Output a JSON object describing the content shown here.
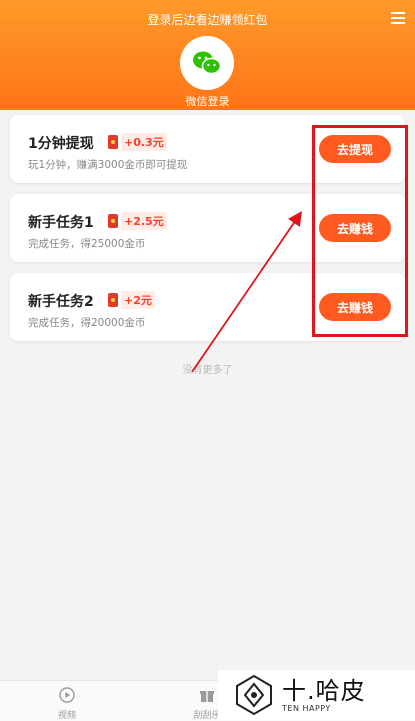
{
  "header": {
    "title": "登录后边看边赚领红包",
    "login_label": "微信登录"
  },
  "tasks": [
    {
      "title": "1分钟提现",
      "reward": "+0.3元",
      "desc": "玩1分钟，赚满3000金币即可提现",
      "button": "去提现"
    },
    {
      "title": "新手任务1",
      "reward": "+2.5元",
      "desc": "完成任务，得25000金币",
      "button": "去赚钱"
    },
    {
      "title": "新手任务2",
      "reward": "+2元",
      "desc": "完成任务，得20000金币",
      "button": "去赚钱"
    }
  ],
  "footer_note": "没有更多了",
  "bottom_nav": [
    {
      "label": "视频",
      "icon": "play-icon"
    },
    {
      "label": "刮刮乐",
      "icon": "gift-icon"
    }
  ],
  "watermark": {
    "main": "十.哈皮",
    "sub": "TEN HAPPY"
  },
  "colors": {
    "header": "#ff7f1e",
    "button": "#ff5a1f",
    "reward": "#ff3d2e",
    "highlight": "#e0151a"
  }
}
